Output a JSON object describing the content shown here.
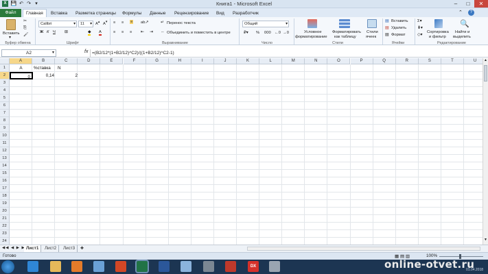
{
  "window": {
    "title": "Книга1  -  Microsoft Excel"
  },
  "tabs": [
    "Файл",
    "Главная",
    "Вставка",
    "Разметка страницы",
    "Формулы",
    "Данные",
    "Рецензирование",
    "Вид",
    "Разработчик"
  ],
  "ribbon": {
    "paste_label": "Вставить",
    "clipboard_group": "Буфер обмена",
    "font_name": "Calibri",
    "font_size": "11",
    "font_group": "Шрифт",
    "wrap_text": "Перенос текста",
    "merge_center": "Объединить и поместить в центре",
    "alignment_group": "Выравнивание",
    "number_format": "Общий",
    "number_group": "Число",
    "conditional_formatting": [
      "Условное",
      "форматирование"
    ],
    "format_as_table": [
      "Форматировать",
      "как таблицу"
    ],
    "cell_styles": [
      "Стили",
      "ячеек"
    ],
    "styles_group": "Стили",
    "insert": "Вставить",
    "delete": "Удалить",
    "format": "Формат",
    "cells_group": "Ячейки",
    "sort_filter": [
      "Сортировка",
      "и фильтр"
    ],
    "find_select": [
      "Найти и",
      "выделить"
    ],
    "editing_group": "Редактирование"
  },
  "formula_bar": {
    "name_box": "A2",
    "fx": "fx",
    "formula": "=(B2/12*(1+B2/12)^C2)/((1+B2/12)^C2-1)"
  },
  "columns": [
    "A",
    "B",
    "C",
    "D",
    "E",
    "F",
    "G",
    "H",
    "I",
    "J",
    "K",
    "L",
    "M",
    "N",
    "O",
    "P",
    "Q",
    "R",
    "S",
    "T",
    "U"
  ],
  "rows": [
    "1",
    "2",
    "3",
    "4",
    "5",
    "6",
    "7",
    "8",
    "9",
    "10",
    "11",
    "12",
    "13",
    "14",
    "15",
    "16",
    "17",
    "18",
    "19",
    "20",
    "21",
    "22",
    "23",
    "24"
  ],
  "cells": {
    "A1": "A",
    "B1": "%ставка",
    "C1": "N",
    "A2": "0",
    "B2": "0,14",
    "C2": "2"
  },
  "sheets": [
    "Лист1",
    "Лист2",
    "Лист3"
  ],
  "status": {
    "ready": "Готово",
    "zoom": "100%"
  },
  "taskbar": {
    "time": "",
    "date": "01.04.2018"
  },
  "watermark": "online-otvet.ru",
  "colors": {
    "excel_green": "#2a7a3b",
    "taskbar": "#1c3552",
    "header_bg": "#e7edf5"
  }
}
